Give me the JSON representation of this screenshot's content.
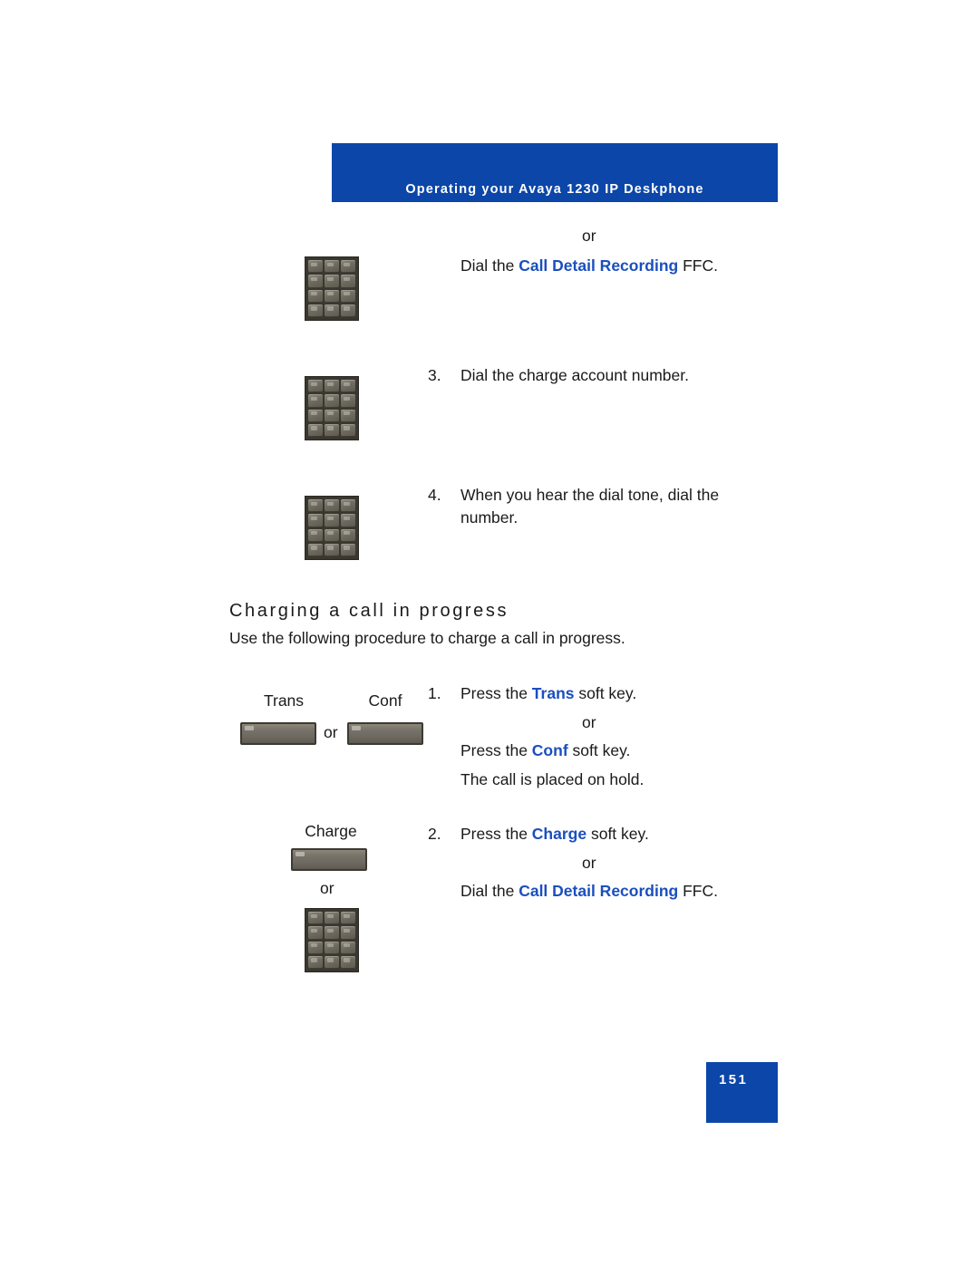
{
  "header": {
    "title": "Operating your Avaya 1230 IP Deskphone"
  },
  "top_section": {
    "or_1": "or",
    "dial_ffc_prefix": "Dial the ",
    "dial_ffc_accent": "Call Detail Recording",
    "dial_ffc_suffix": " FFC.",
    "step3_num": "3.",
    "step3_text": "Dial the charge account number.",
    "step4_num": "4.",
    "step4_text": "When you hear the dial tone, dial the number."
  },
  "section": {
    "heading": "Charging a call in progress",
    "intro": "Use the following procedure to charge a call in progress."
  },
  "procedure": {
    "softkey_trans_label": "Trans",
    "softkey_conf_label": "Conf",
    "softkey_or": "or",
    "softkey_charge_label": "Charge",
    "charge_or_below": "or",
    "step1_num": "1.",
    "step1_prefix": "Press the ",
    "step1_accent": "Trans",
    "step1_suffix": " soft key.",
    "step1_or": "or",
    "step1b_prefix": "Press the ",
    "step1b_accent": "Conf",
    "step1b_suffix": " soft key.",
    "step1c_text": "The call is placed on hold.",
    "step2_num": "2.",
    "step2_prefix": "Press the ",
    "step2_accent": "Charge",
    "step2_suffix": " soft key.",
    "step2_or": "or",
    "step2b_prefix": "Dial the ",
    "step2b_accent": "Call Detail Recording",
    "step2b_suffix": " FFC."
  },
  "footer": {
    "page_number": "151"
  },
  "colors": {
    "brand_blue": "#0b46a8",
    "accent_blue": "#1a4fbe",
    "text": "#1a1a1a",
    "key_gray": "#6f6b60"
  }
}
